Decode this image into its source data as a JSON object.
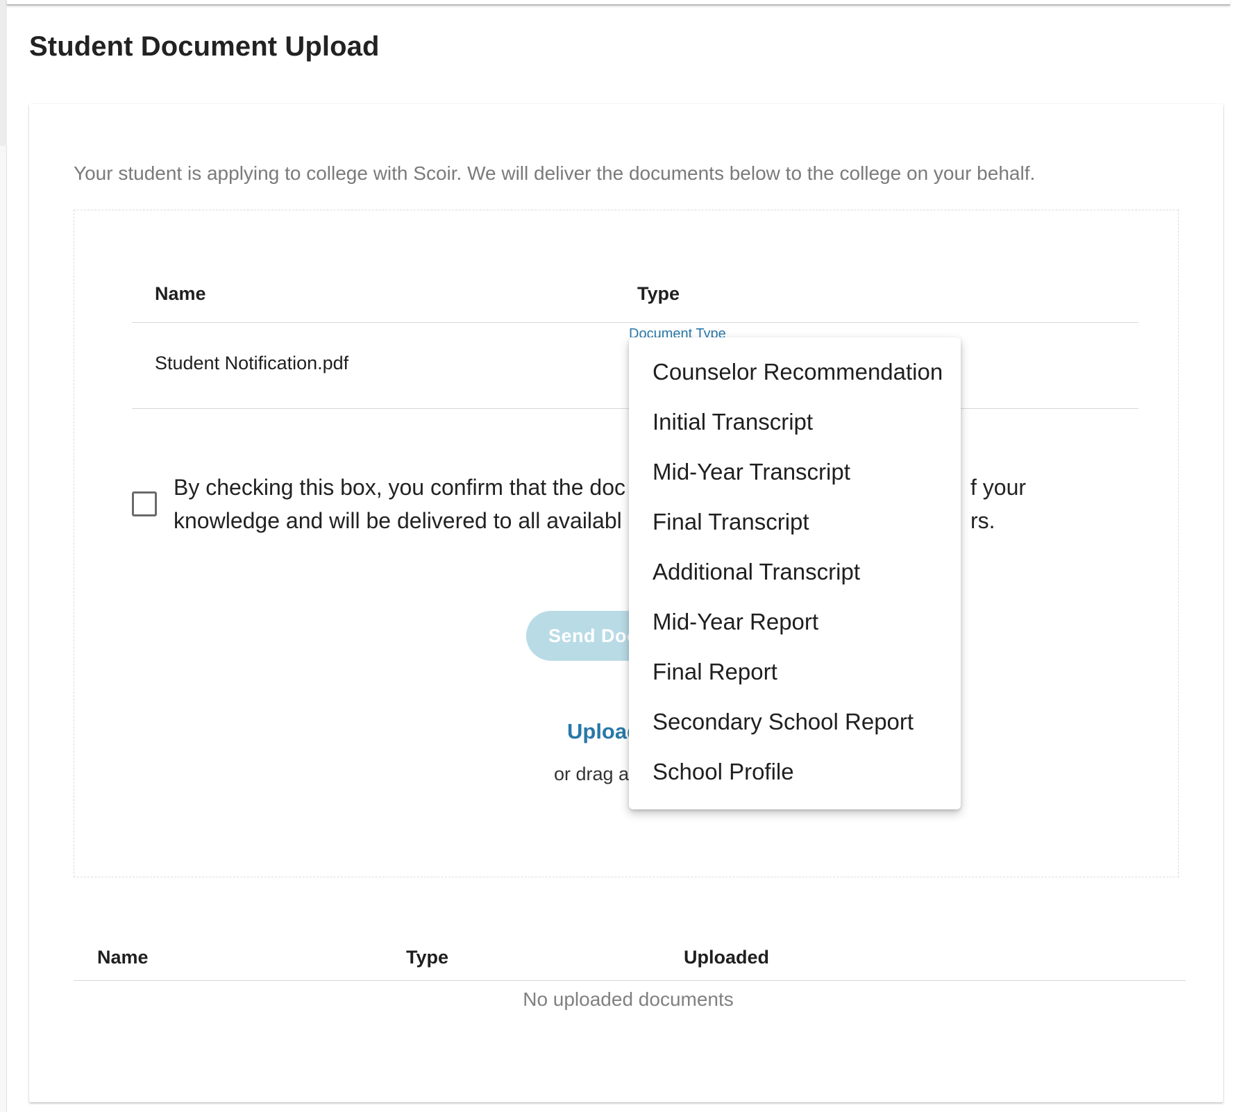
{
  "page": {
    "title": "Student Document Upload",
    "intro": "Your student is applying to college with Scoir. We will deliver the documents below to the college on your behalf."
  },
  "pending_table": {
    "headers": {
      "name": "Name",
      "type": "Type"
    },
    "rows": [
      {
        "name": "Student Notification.pdf",
        "type_label": "Document Type"
      }
    ]
  },
  "confirm": {
    "line1": "By checking this box, you confirm that the doc",
    "line1_tail": "f your",
    "line2": "knowledge and will be delivered to all availabl",
    "line2_tail": "rs.",
    "checked": false
  },
  "actions": {
    "send_label": "Send Doc",
    "upload_label": "Upload",
    "drag_label": "or drag a"
  },
  "uploaded_table": {
    "headers": {
      "name": "Name",
      "type": "Type",
      "uploaded": "Uploaded"
    },
    "empty_message": "No uploaded documents"
  },
  "document_type_menu": {
    "items": [
      "Counselor Recommendation",
      "Initial Transcript",
      "Mid-Year Transcript",
      "Final Transcript",
      "Additional Transcript",
      "Mid-Year Report",
      "Final Report",
      "Secondary School Report",
      "School Profile"
    ]
  },
  "colors": {
    "accent": "#2878a8",
    "button_disabled": "#b9dbe6",
    "muted_text": "#7a7a7a"
  }
}
